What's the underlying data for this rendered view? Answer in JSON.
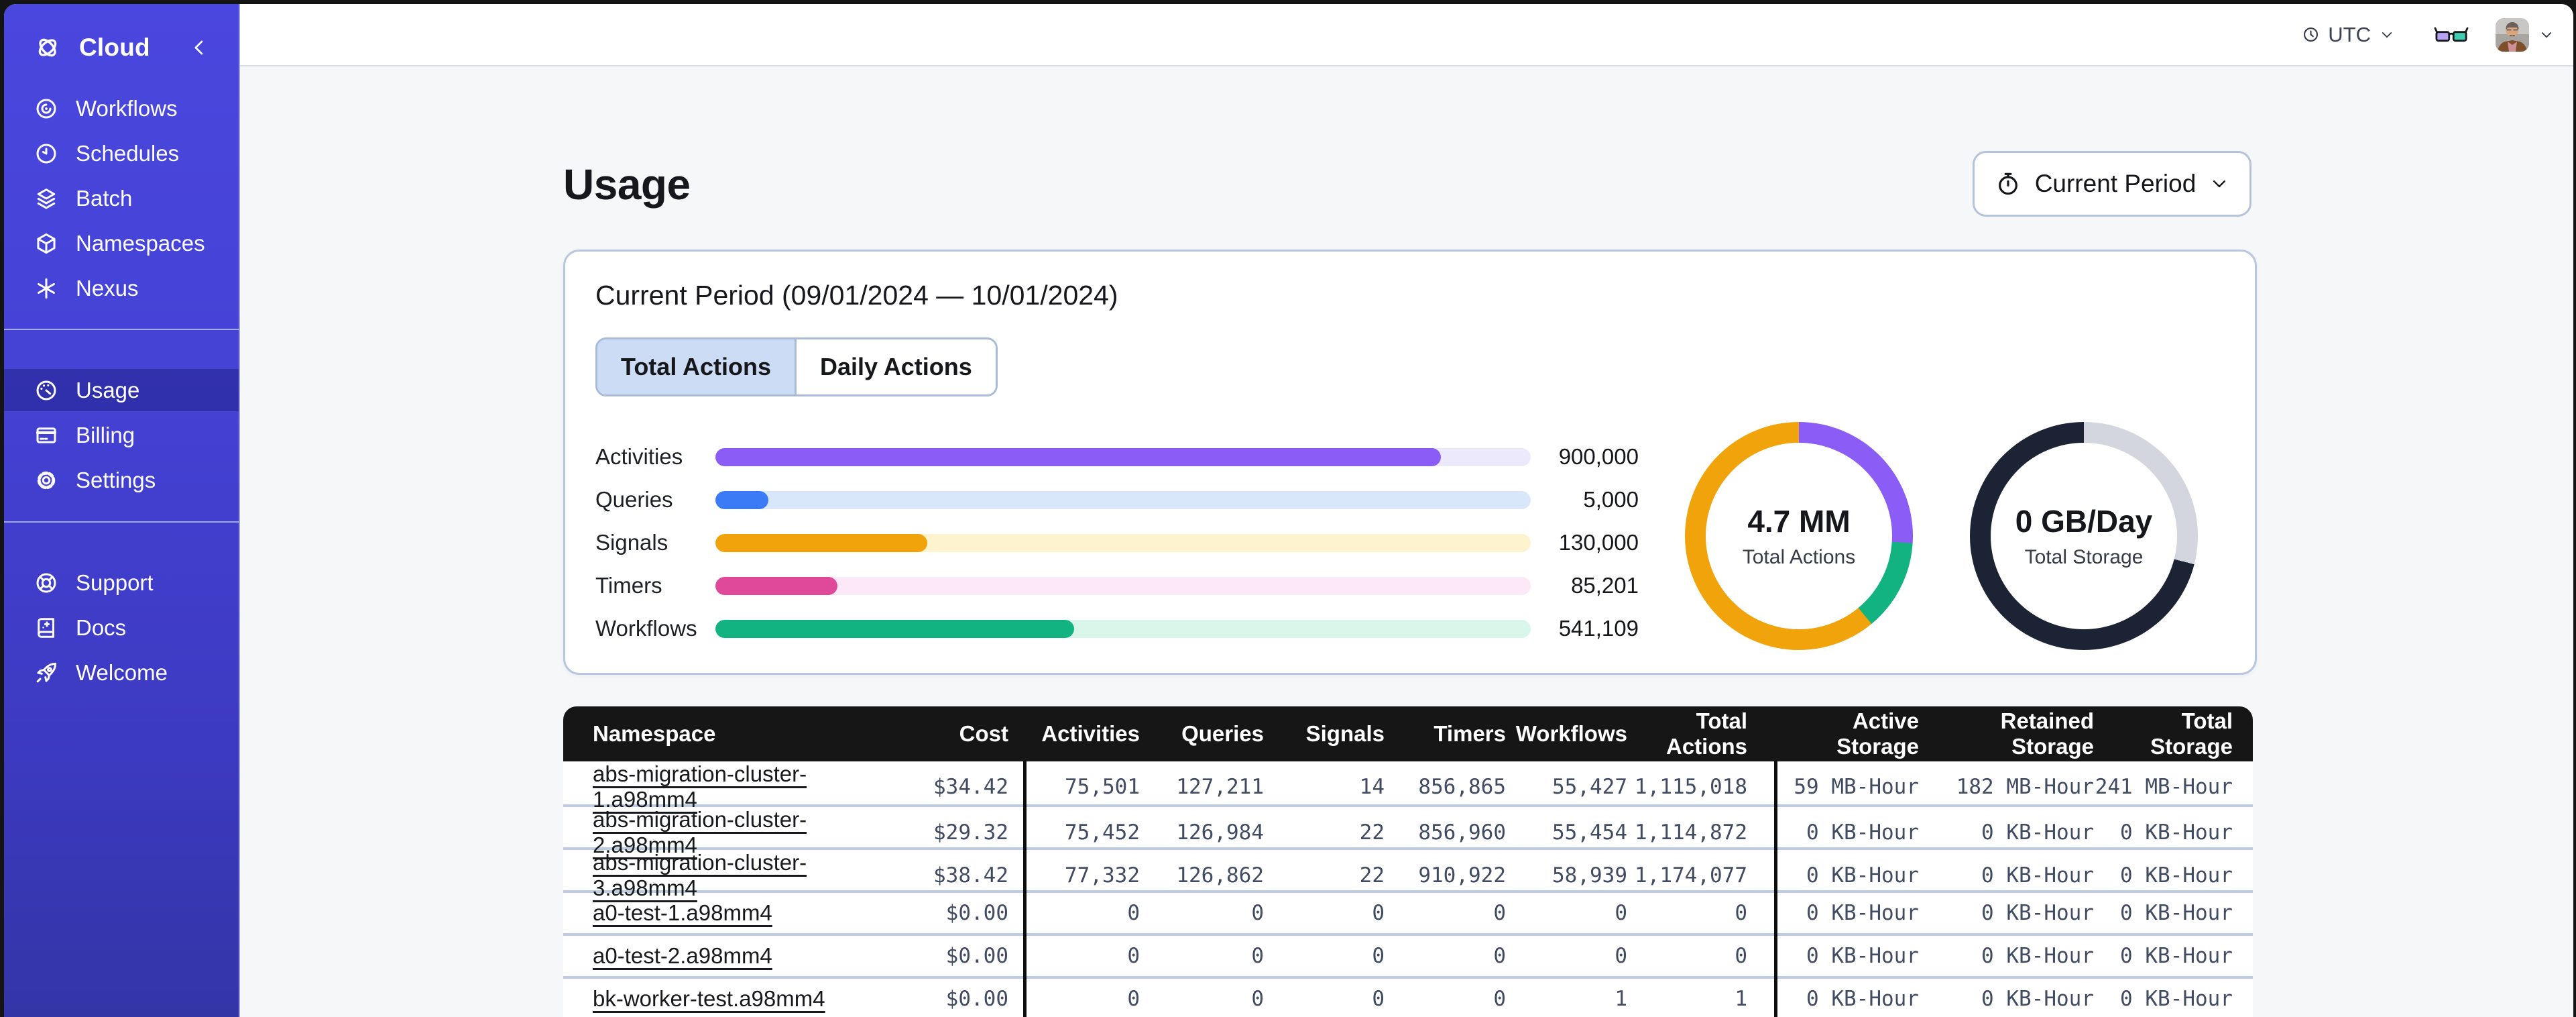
{
  "chrome": {
    "backdrop_color": "#141414",
    "window_bg": "#f6f7f9"
  },
  "sidebar": {
    "colors": {
      "bg_top": "#4a47de",
      "bg_bottom": "#3335a6",
      "active_overlay": "rgba(8,10,78,0.30)"
    },
    "brand": {
      "label": "Cloud",
      "icon": "temporal-logo-icon",
      "collapse_icon": "chevron-left-icon"
    },
    "sections": [
      {
        "name": "platform",
        "items": [
          {
            "label": "Workflows",
            "icon": "workflows-icon"
          },
          {
            "label": "Schedules",
            "icon": "schedules-icon"
          },
          {
            "label": "Batch",
            "icon": "batch-icon"
          },
          {
            "label": "Namespaces",
            "icon": "namespaces-icon"
          },
          {
            "label": "Nexus",
            "icon": "nexus-icon"
          }
        ]
      },
      {
        "name": "account",
        "items": [
          {
            "label": "Usage",
            "icon": "usage-icon",
            "active": true
          },
          {
            "label": "Billing",
            "icon": "billing-icon"
          },
          {
            "label": "Settings",
            "icon": "settings-icon"
          }
        ]
      },
      {
        "name": "help",
        "items": [
          {
            "label": "Support",
            "icon": "support-icon"
          },
          {
            "label": "Docs",
            "icon": "docs-icon"
          },
          {
            "label": "Welcome",
            "icon": "welcome-icon"
          }
        ]
      }
    ]
  },
  "topbar": {
    "timezone": {
      "icon": "clock-icon",
      "label": "UTC",
      "chevron_icon": "chevron-down-icon"
    },
    "glasses_icon": "glasses-icon",
    "avatar_icon": "avatar-photo",
    "user_chevron_icon": "chevron-down-icon"
  },
  "page": {
    "title": "Usage",
    "period_selector": {
      "icon": "stopwatch-icon",
      "label": "Current Period",
      "chevron_icon": "chevron-down-icon"
    }
  },
  "usage_card": {
    "title": "Current Period (09/01/2024 — 10/01/2024)",
    "tabs": [
      {
        "label": "Total Actions",
        "active": true
      },
      {
        "label": "Daily Actions",
        "active": false
      }
    ],
    "chart_data": {
      "type": "bar",
      "categories": [
        "Activities",
        "Queries",
        "Signals",
        "Timers",
        "Workflows"
      ],
      "values": [
        900000,
        5000,
        130000,
        85201,
        541109
      ],
      "display_values": [
        "900,000",
        "5,000",
        "130,000",
        "85,201",
        "541,109"
      ],
      "bar_fill_pct": [
        89,
        6.5,
        26,
        15,
        44
      ],
      "bar_colors": [
        "#8b5cf6",
        "#3b7cf6",
        "#f0a30a",
        "#e0489a",
        "#12b380"
      ],
      "track_colors": [
        "#ece9fd",
        "#d9e7fb",
        "#fdf3cf",
        "#fce8f6",
        "#d9f6ea"
      ]
    },
    "donuts": [
      {
        "value": "4.7 MM",
        "label": "Total Actions",
        "segments": [
          {
            "color": "#8b5cf6",
            "pct": 26
          },
          {
            "color": "#12b380",
            "pct": 13
          },
          {
            "color": "#f0a30a",
            "pct": 61
          }
        ]
      },
      {
        "value": "0 GB/Day",
        "label": "Total Storage",
        "segments": [
          {
            "color": "#d3d6de",
            "pct": 29
          },
          {
            "color": "#1c2334",
            "pct": 71
          }
        ]
      }
    ]
  },
  "namespace_table": {
    "columns": [
      "Namespace",
      "Cost",
      "Activities",
      "Queries",
      "Signals",
      "Timers",
      "Workflows",
      "Total Actions",
      "Active Storage",
      "Retained Storage",
      "Total Storage"
    ],
    "rows": [
      [
        "abs-migration-cluster-1.a98mm4",
        "$34.42",
        "75,501",
        "127,211",
        "14",
        "856,865",
        "55,427",
        "1,115,018",
        "59 MB-Hour",
        "182 MB-Hour",
        "241 MB-Hour"
      ],
      [
        "abs-migration-cluster-2.a98mm4",
        "$29.32",
        "75,452",
        "126,984",
        "22",
        "856,960",
        "55,454",
        "1,114,872",
        "0 KB-Hour",
        "0 KB-Hour",
        "0 KB-Hour"
      ],
      [
        "abs-migration-cluster-3.a98mm4",
        "$38.42",
        "77,332",
        "126,862",
        "22",
        "910,922",
        "58,939",
        "1,174,077",
        "0 KB-Hour",
        "0 KB-Hour",
        "0 KB-Hour"
      ],
      [
        "a0-test-1.a98mm4",
        "$0.00",
        "0",
        "0",
        "0",
        "0",
        "0",
        "0",
        "0 KB-Hour",
        "0 KB-Hour",
        "0 KB-Hour"
      ],
      [
        "a0-test-2.a98mm4",
        "$0.00",
        "0",
        "0",
        "0",
        "0",
        "0",
        "0",
        "0 KB-Hour",
        "0 KB-Hour",
        "0 KB-Hour"
      ],
      [
        "bk-worker-test.a98mm4",
        "$0.00",
        "0",
        "0",
        "0",
        "0",
        "1",
        "1",
        "0 KB-Hour",
        "0 KB-Hour",
        "0 KB-Hour"
      ]
    ]
  }
}
